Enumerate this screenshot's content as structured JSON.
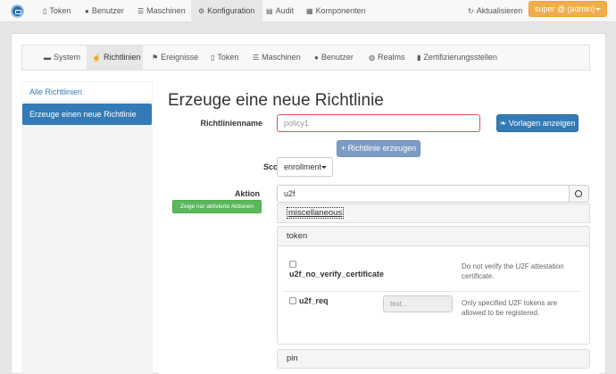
{
  "navbar": {
    "items": [
      {
        "label": "Token",
        "icon": "phone-icon"
      },
      {
        "label": "Benutzer",
        "icon": "user-icon"
      },
      {
        "label": "Maschinen",
        "icon": "list-icon"
      },
      {
        "label": "Konfiguration",
        "icon": "gear-icon",
        "active": true
      },
      {
        "label": "Audit",
        "icon": "audit-icon"
      },
      {
        "label": "Komponenten",
        "icon": "components-icon"
      }
    ],
    "refresh_label": "Aktualisieren",
    "user_label": "super @ (admin)"
  },
  "subnav": {
    "items": [
      {
        "label": "System"
      },
      {
        "label": "Richtlinien",
        "active": true
      },
      {
        "label": "Ereignisse"
      },
      {
        "label": "Token"
      },
      {
        "label": "Maschinen"
      },
      {
        "label": "Benutzer"
      },
      {
        "label": "Realms"
      },
      {
        "label": "Zertifizierungsstellen"
      }
    ]
  },
  "sidebar": {
    "all_policies": "Alle Richtlinien",
    "new_policy": "Erzeuge einen neue Richtlinie"
  },
  "main": {
    "title": "Erzeuge eine neue Richtlinie",
    "name_label": "Richtlinienname",
    "name_placeholder": "policy1",
    "templates_button": "Vorlagen anzeigen",
    "create_button": "+ Richtlinie erzeugen",
    "scope_label": "Scope",
    "scope_value": "enrollment",
    "action_label": "Aktion",
    "action_value": "u2f",
    "show_active_button": "Zeige nur aktivierte Aktionen",
    "groups": {
      "miscellaneous": "miscellaneous",
      "token": "token",
      "pin": "pin"
    },
    "actions": [
      {
        "name": "u2f_no_verify_certificate",
        "description": "Do not verify the U2F attestation certificate."
      },
      {
        "name": "u2f_req",
        "description": "Only specified U2F tokens are allowed to be registered.",
        "input_placeholder": "text..."
      }
    ]
  },
  "colors": {
    "primary": "#337ab7",
    "warning": "#f0ad4e",
    "success": "#5cb85c",
    "danger_border": "#d9534f"
  }
}
